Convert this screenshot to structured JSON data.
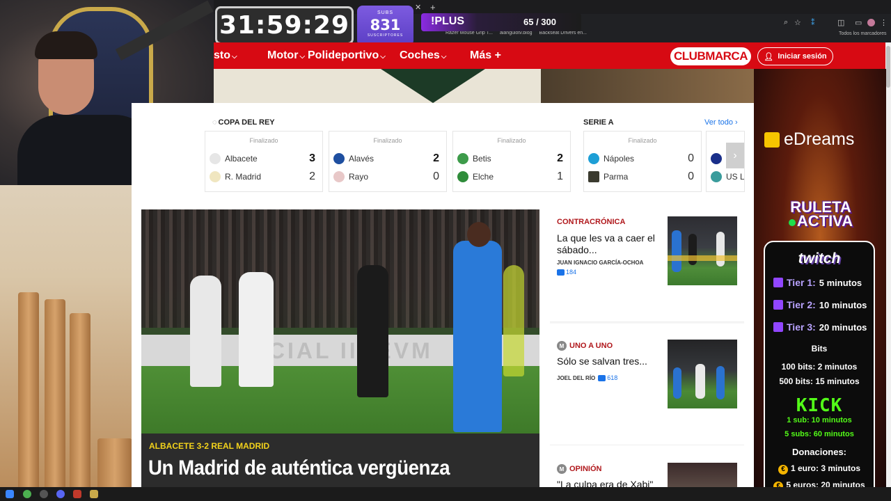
{
  "overlay": {
    "timer": "31:59:29",
    "subs_label": "SUBS",
    "subs_count": "831",
    "subs_caption": "SUSCRIPTORES",
    "plus_label": "!PLUS",
    "plus_count": "65 / 300"
  },
  "browser": {
    "bookmarks": [
      "Razer Mouse Grip T...",
      "alangulotv.blog",
      "Backseat Drivers en..."
    ],
    "bookmarks_all": "Todos los marcadores"
  },
  "nav": {
    "items": [
      {
        "label": "sto",
        "chevron": true
      },
      {
        "label": "Motor",
        "chevron": true
      },
      {
        "label": "Polideportivo",
        "chevron": true
      },
      {
        "label": "Coches",
        "chevron": true
      },
      {
        "label": "Más +",
        "chevron": false
      }
    ],
    "club_marca": "CLUBMARCA",
    "login": "Iniciar sesión"
  },
  "scores": {
    "competition_1": "COPA DEL REY",
    "competition_2": "SERIE A",
    "see_all": "Ver todo",
    "status": "Finalizado",
    "matches": [
      {
        "home": "Albacete",
        "home_score": "3",
        "away": "R. Madrid",
        "away_score": "2"
      },
      {
        "home": "Alavés",
        "home_score": "2",
        "away": "Rayo",
        "away_score": "0"
      },
      {
        "home": "Betis",
        "home_score": "2",
        "away": "Elche",
        "away_score": "1"
      },
      {
        "home": "Nápoles",
        "home_score": "0",
        "away": "Parma",
        "away_score": "0"
      },
      {
        "home": "",
        "home_score": "",
        "away": "US L",
        "away_score": ""
      }
    ]
  },
  "main_story": {
    "board_text": "ICIAL IIIIEVM",
    "kicker": "ALBACETE 3-2 REAL MADRID",
    "headline": "Un Madrid de auténtica vergüenza"
  },
  "side_stories": [
    {
      "kicker": "CONTRACRÓNICA",
      "title": "La que les va a caer el sábado...",
      "author": "JUAN IGNACIO GARCÍA-OCHOA",
      "comments": "184"
    },
    {
      "kicker": "UNO A UNO",
      "title": "Sólo se salvan tres...",
      "author": "JOEL DEL RÍO",
      "comments": "618"
    },
    {
      "kicker": "OPINIÓN",
      "title": "\"La culpa era de Xabi\"",
      "author": "",
      "comments": ""
    }
  ],
  "sidebar": {
    "edreams": "eDreams",
    "ruleta_1": "RULETA",
    "ruleta_2": "ACTIVA",
    "twitch": "twitch",
    "tiers": [
      {
        "label": "Tier 1:",
        "value": "5 minutos"
      },
      {
        "label": "Tier 2:",
        "value": "10 minutos"
      },
      {
        "label": "Tier 3:",
        "value": "20 minutos"
      }
    ],
    "bits_title": "Bits",
    "bits": [
      "100 bits: 2 minutos",
      "500 bits: 15 minutos"
    ],
    "kick": "KICK",
    "kick_lines": [
      "1 sub: 10 minutos",
      "5 subs: 60 minutos"
    ],
    "donations_title": "Donaciones:",
    "donations": [
      "1 euro: 3 minutos",
      "5 euros: 20 minutos"
    ]
  },
  "colors": {
    "marca_red": "#d70a13",
    "kicker_yellow": "#f3d21b",
    "twitch_purple": "#9146ff",
    "kick_green": "#53fc18"
  }
}
